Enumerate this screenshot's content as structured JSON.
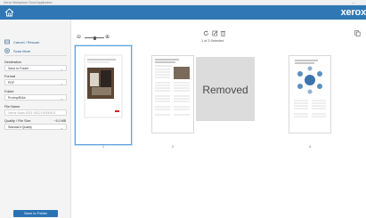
{
  "window": {
    "title": "Xerox Workplace Cloud Application",
    "minimize_glyph": "—"
  },
  "header": {
    "home_icon": "home-icon",
    "brand": "xerox",
    "brand_color": "#2f78b5"
  },
  "sidebar": {
    "nav": [
      {
        "label": "Cancel / Rescan",
        "icon": "scanner-icon"
      },
      {
        "label": "Scan More",
        "icon": "add-circle-icon"
      }
    ],
    "destination": {
      "label": "Destination",
      "value": "Save to Folder"
    },
    "format": {
      "label": "Format",
      "value": "PDF"
    },
    "folder": {
      "label": "Folder",
      "value": "ProImpR/Ab"
    },
    "file_name": {
      "label": "File Name",
      "placeholder": "Xerox Scan 2021 0012 01000101"
    },
    "quality": {
      "label": "Quality / File Size",
      "size": "~5.0 MB",
      "value": "Standard Quality"
    },
    "save_button": "Save to Folder"
  },
  "toolbar": {
    "zoom_out": "⊖",
    "zoom_in": "⊕",
    "zoom_level": 0.45,
    "icons": [
      "rotate-icon",
      "edit-icon",
      "delete-icon"
    ],
    "selection_text": "1 of 3 Selected",
    "right_icon": "copy-icon"
  },
  "pages": [
    {
      "num": "1",
      "selected": true,
      "title": "Brochure Cover Page Ver 2"
    },
    {
      "num": "2",
      "selected": false,
      "title": "Welcome to the Xerox Workplace Cloud"
    },
    {
      "num": "",
      "removed": true,
      "label": "Removed"
    },
    {
      "num": "4",
      "selected": false,
      "title": "Our Business Solutions"
    }
  ],
  "colors": {
    "accent": "#2a73b3",
    "selected_border": "#5fa2dd",
    "removed_bg": "#dcdcdc"
  }
}
